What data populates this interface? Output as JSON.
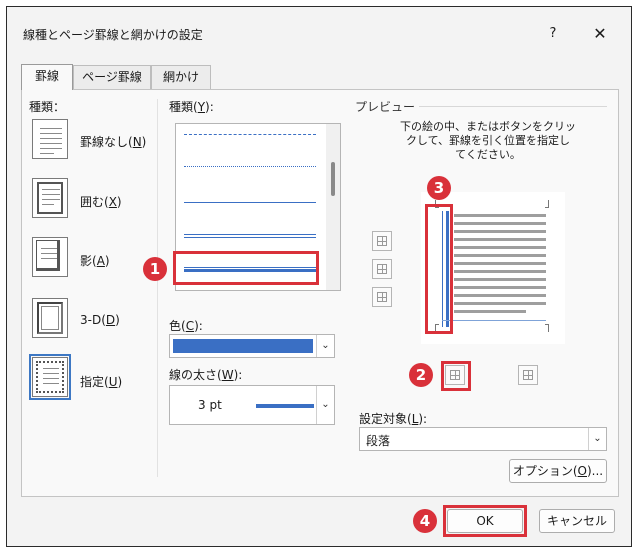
{
  "window": {
    "title": "線種とページ罫線と網かけの設定",
    "help_label": "?",
    "close_label": "✕"
  },
  "tabs": [
    {
      "label": "罫線",
      "active": true
    },
    {
      "label": "ページ罫線",
      "active": false
    },
    {
      "label": "網かけ",
      "active": false
    }
  ],
  "setting_type": {
    "heading": "種類：",
    "options": [
      {
        "label": "罫線なし(",
        "key": "N",
        "selected": false
      },
      {
        "label": "囲む(",
        "key": "X",
        "selected": false
      },
      {
        "label": "影(",
        "key": "A",
        "selected": false
      },
      {
        "label": "3-D(",
        "key": "D",
        "selected": false
      },
      {
        "label": "指定(",
        "key": "U",
        "selected": true
      }
    ]
  },
  "style": {
    "heading": "種類(",
    "heading_key": "Y",
    "heading_suffix": "):",
    "samples": [
      "dash-dot",
      "dotted",
      "single",
      "double",
      "thick-thin"
    ]
  },
  "color": {
    "label": "色(",
    "key": "C",
    "suffix": "):",
    "value_color": "#3a6fc4"
  },
  "width": {
    "label": "線の太さ(",
    "key": "W",
    "suffix": "):",
    "value": "3 pt"
  },
  "preview": {
    "heading": "プレビュー",
    "instruction_lines": [
      "下の絵の中、またはボタンをクリッ",
      "クして、罫線を引く位置を指定し",
      "てください。"
    ]
  },
  "apply_to": {
    "label": "設定対象(",
    "key": "L",
    "suffix": "):",
    "value": "段落"
  },
  "buttons": {
    "options_label": "オプション(",
    "options_key": "O",
    "options_suffix": ")...",
    "ok_label": "OK",
    "cancel_label": "キャンセル"
  },
  "annotations": {
    "badge1": "1",
    "badge2": "2",
    "badge3": "3",
    "badge4": "4",
    "highlight_color": "#d9313a"
  },
  "icons": {
    "chevron": "chevron-down-icon",
    "border_button": "border-grid-icon"
  }
}
